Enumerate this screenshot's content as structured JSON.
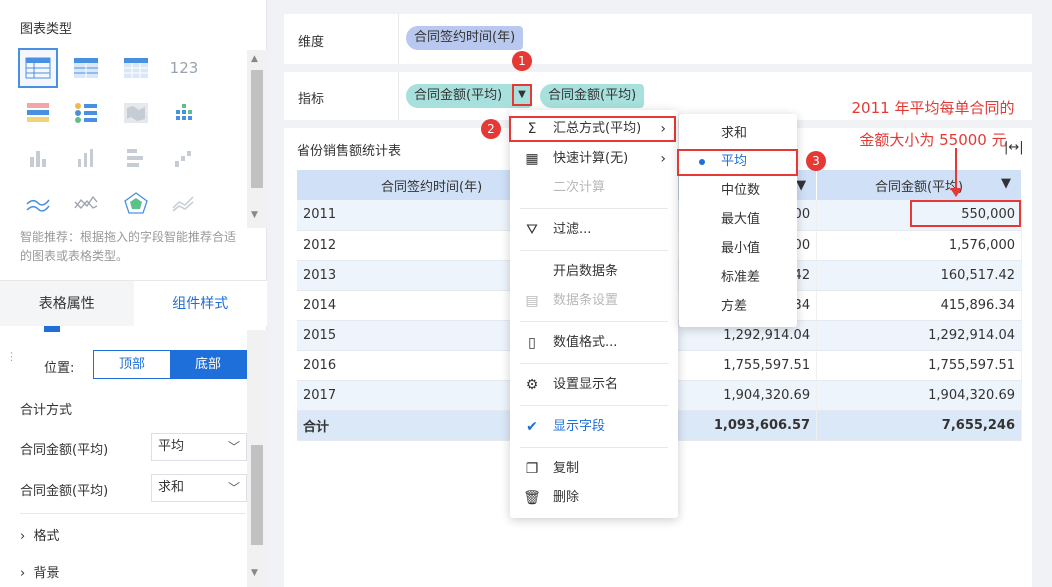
{
  "left_panel": {
    "chart_type_title": "图表类型",
    "hint": "智能推荐：根据拖入的字段智能推荐合适的图表或表格类型。",
    "tabs": [
      "表格属性",
      "组件样式"
    ],
    "position_label": "位置:",
    "position_options": [
      "顶部",
      "底部"
    ],
    "position_selected": "底部",
    "total_method_title": "合计方式",
    "total_rows": [
      {
        "label": "合同金额(平均)",
        "value": "平均"
      },
      {
        "label": "合同金额(平均)",
        "value": "求和"
      }
    ],
    "fold_sections": [
      "格式",
      "背景"
    ],
    "icons": [
      "table-icon",
      "crosstab-icon",
      "detail-table-icon",
      "kpi-number-icon",
      "report-table-icon",
      "multi-kpi-icon",
      "map-icon",
      "grid-chart-icon",
      "bar-chart-icon",
      "column-chart-icon",
      "stacked-bar-icon",
      "waterfall-icon",
      "area-chart-icon",
      "line-chart-icon",
      "radar-chart-icon",
      "scatter-chart-icon"
    ]
  },
  "config": {
    "dimension_label": "维度",
    "dimension_pill": "合同签约时间(年)",
    "metric_label": "指标",
    "metric_pills": [
      "合同金额(平均)",
      "合同金额(平均)"
    ]
  },
  "table": {
    "title": "省份销售额统计表",
    "headers": [
      "合同签约时间(年)",
      "",
      "合同金额(平均)"
    ],
    "rows": [
      {
        "year": "2011",
        "v1": "00",
        "v2": "550,000"
      },
      {
        "year": "2012",
        "v1": "00",
        "v2": "1,576,000"
      },
      {
        "year": "2013",
        "v1": "42",
        "v2": "160,517.42"
      },
      {
        "year": "2014",
        "v1": "34",
        "v2": "415,896.34"
      },
      {
        "year": "2015",
        "v1": "1,292,914.04",
        "v2": "1,292,914.04"
      },
      {
        "year": "2016",
        "v1": "1,755,597.51",
        "v2": "1,755,597.51"
      },
      {
        "year": "2017",
        "v1": "1,904,320.69",
        "v2": "1,904,320.69"
      }
    ],
    "total": {
      "label": "合计",
      "v1": "1,093,606.57",
      "v2": "7,655,246"
    }
  },
  "context_menu": {
    "items": [
      {
        "label": "汇总方式(平均)",
        "icon": "sigma-icon"
      },
      {
        "label": "快速计算(无)",
        "icon": "calculator-icon"
      },
      {
        "label": "二次计算",
        "icon": ""
      },
      {
        "label": "过滤...",
        "icon": "filter-icon"
      },
      {
        "label": "开启数据条",
        "icon": ""
      },
      {
        "label": "数据条设置",
        "icon": "databar-icon"
      },
      {
        "label": "数值格式...",
        "icon": "number-format-icon"
      },
      {
        "label": "设置显示名",
        "icon": "gear-icon"
      },
      {
        "label": "显示字段",
        "icon": "check-icon"
      },
      {
        "label": "复制",
        "icon": "copy-icon"
      },
      {
        "label": "删除",
        "icon": "trash-icon"
      }
    ]
  },
  "submenu": {
    "items": [
      "求和",
      "平均",
      "中位数",
      "最大值",
      "最小值",
      "标准差",
      "方差"
    ],
    "selected": "平均"
  },
  "badges": [
    "1",
    "2",
    "3"
  ],
  "annotation": {
    "line1": "2011 年平均每单合同的",
    "line2": "金额大小为 55000 元"
  }
}
